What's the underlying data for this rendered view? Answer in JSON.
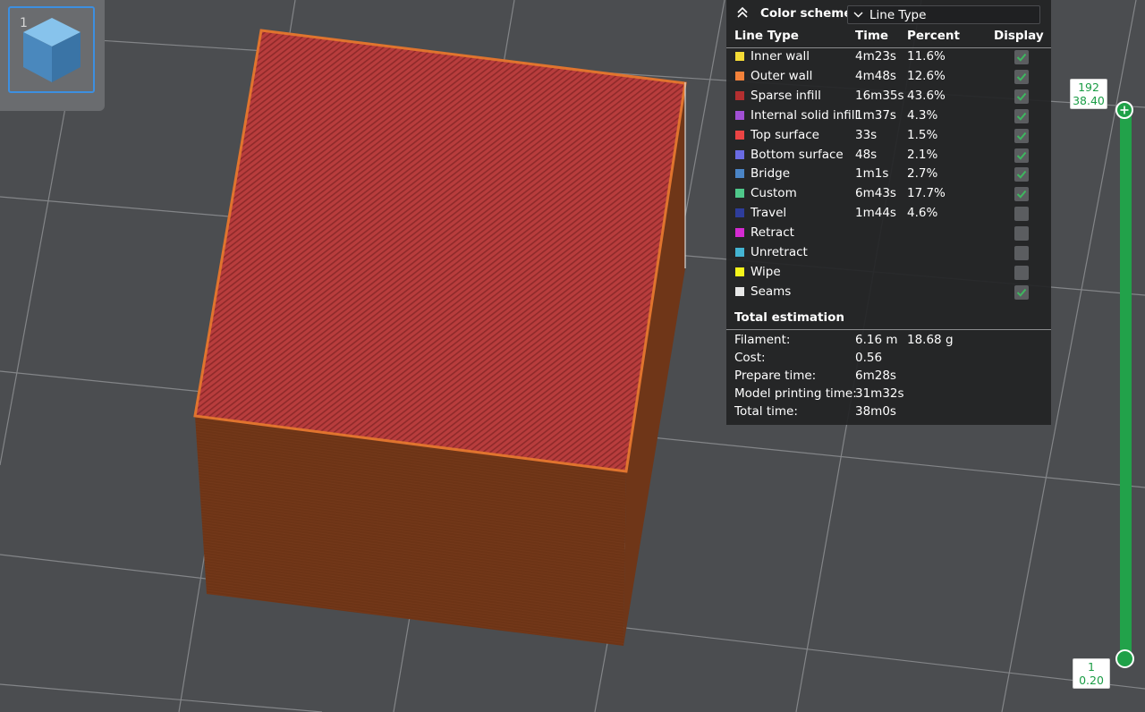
{
  "object_list": {
    "index": "1"
  },
  "legend": {
    "scheme_label": "Color scheme",
    "scheme_value": "Line Type",
    "columns": {
      "type": "Line Type",
      "time": "Time",
      "percent": "Percent",
      "display": "Display"
    },
    "rows": [
      {
        "name": "Inner wall",
        "time": "4m23s",
        "percent": "11.6%",
        "color": "#f5dc36",
        "display": true
      },
      {
        "name": "Outer wall",
        "time": "4m48s",
        "percent": "12.6%",
        "color": "#f4823a",
        "display": true
      },
      {
        "name": "Sparse infill",
        "time": "16m35s",
        "percent": "43.6%",
        "color": "#b32f30",
        "display": true
      },
      {
        "name": "Internal solid infill",
        "time": "1m37s",
        "percent": "4.3%",
        "color": "#a14fd4",
        "display": true
      },
      {
        "name": "Top surface",
        "time": "33s",
        "percent": "1.5%",
        "color": "#eb4444",
        "display": true
      },
      {
        "name": "Bottom surface",
        "time": "48s",
        "percent": "2.1%",
        "color": "#6a6be3",
        "display": true
      },
      {
        "name": "Bridge",
        "time": "1m1s",
        "percent": "2.7%",
        "color": "#4b85c6",
        "display": true
      },
      {
        "name": "Custom",
        "time": "6m43s",
        "percent": "17.7%",
        "color": "#4fc88a",
        "display": true
      },
      {
        "name": "Travel",
        "time": "1m44s",
        "percent": "4.6%",
        "color": "#2e3d9b",
        "display": false
      },
      {
        "name": "Retract",
        "time": "",
        "percent": "",
        "color": "#d52bd2",
        "display": false
      },
      {
        "name": "Unretract",
        "time": "",
        "percent": "",
        "color": "#44b4d2",
        "display": false
      },
      {
        "name": "Wipe",
        "time": "",
        "percent": "",
        "color": "#f5f51b",
        "display": false
      },
      {
        "name": "Seams",
        "time": "",
        "percent": "",
        "color": "#e8e8e8",
        "display": true
      }
    ],
    "total_title": "Total estimation",
    "estimation": [
      {
        "label": "Filament:",
        "value": "6.16 m",
        "value2": "18.68 g"
      },
      {
        "label": "Cost:",
        "value": "0.56",
        "value2": ""
      },
      {
        "label": "Prepare time:",
        "value": "6m28s",
        "value2": ""
      },
      {
        "label": "Model printing time:",
        "value": "31m32s",
        "value2": ""
      },
      {
        "label": "Total time:",
        "value": "38m0s",
        "value2": ""
      }
    ]
  },
  "slider": {
    "top_layer": "192",
    "top_height": "38.40",
    "bottom_layer": "1",
    "bottom_height": "0.20",
    "accent": "#22a24a"
  },
  "colors": {
    "background": "#4b4d50",
    "model_side": "#6b3317",
    "model_top": "#b63a3a"
  }
}
